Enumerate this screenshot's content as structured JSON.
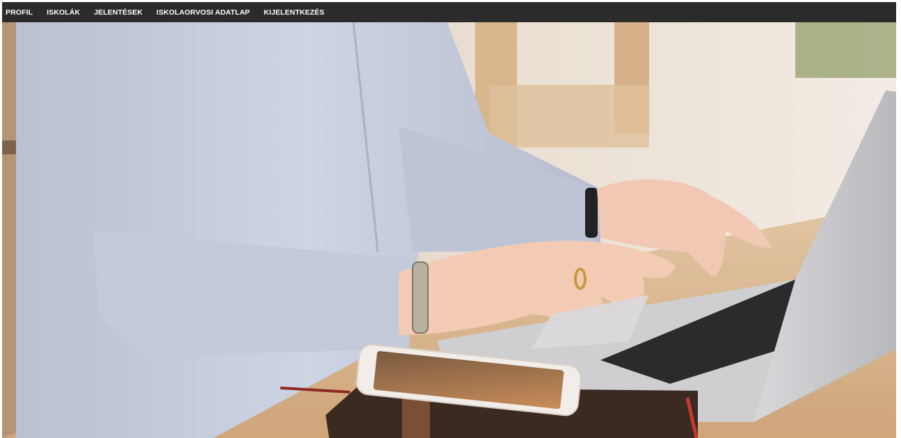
{
  "nav": {
    "items": [
      {
        "label": "PROFIL"
      },
      {
        "label": "ISKOLÁK"
      },
      {
        "label": "JELENTÉSEK"
      },
      {
        "label": "ISKOLAORVOSI ADATLAP"
      },
      {
        "label": "KIJELENTKEZÉS"
      }
    ]
  },
  "hero": {
    "image": "woman-typing-on-laptop-photo"
  },
  "colors": {
    "navbar_bg": "#2b2b2b",
    "nav_text": "#ffffff"
  }
}
